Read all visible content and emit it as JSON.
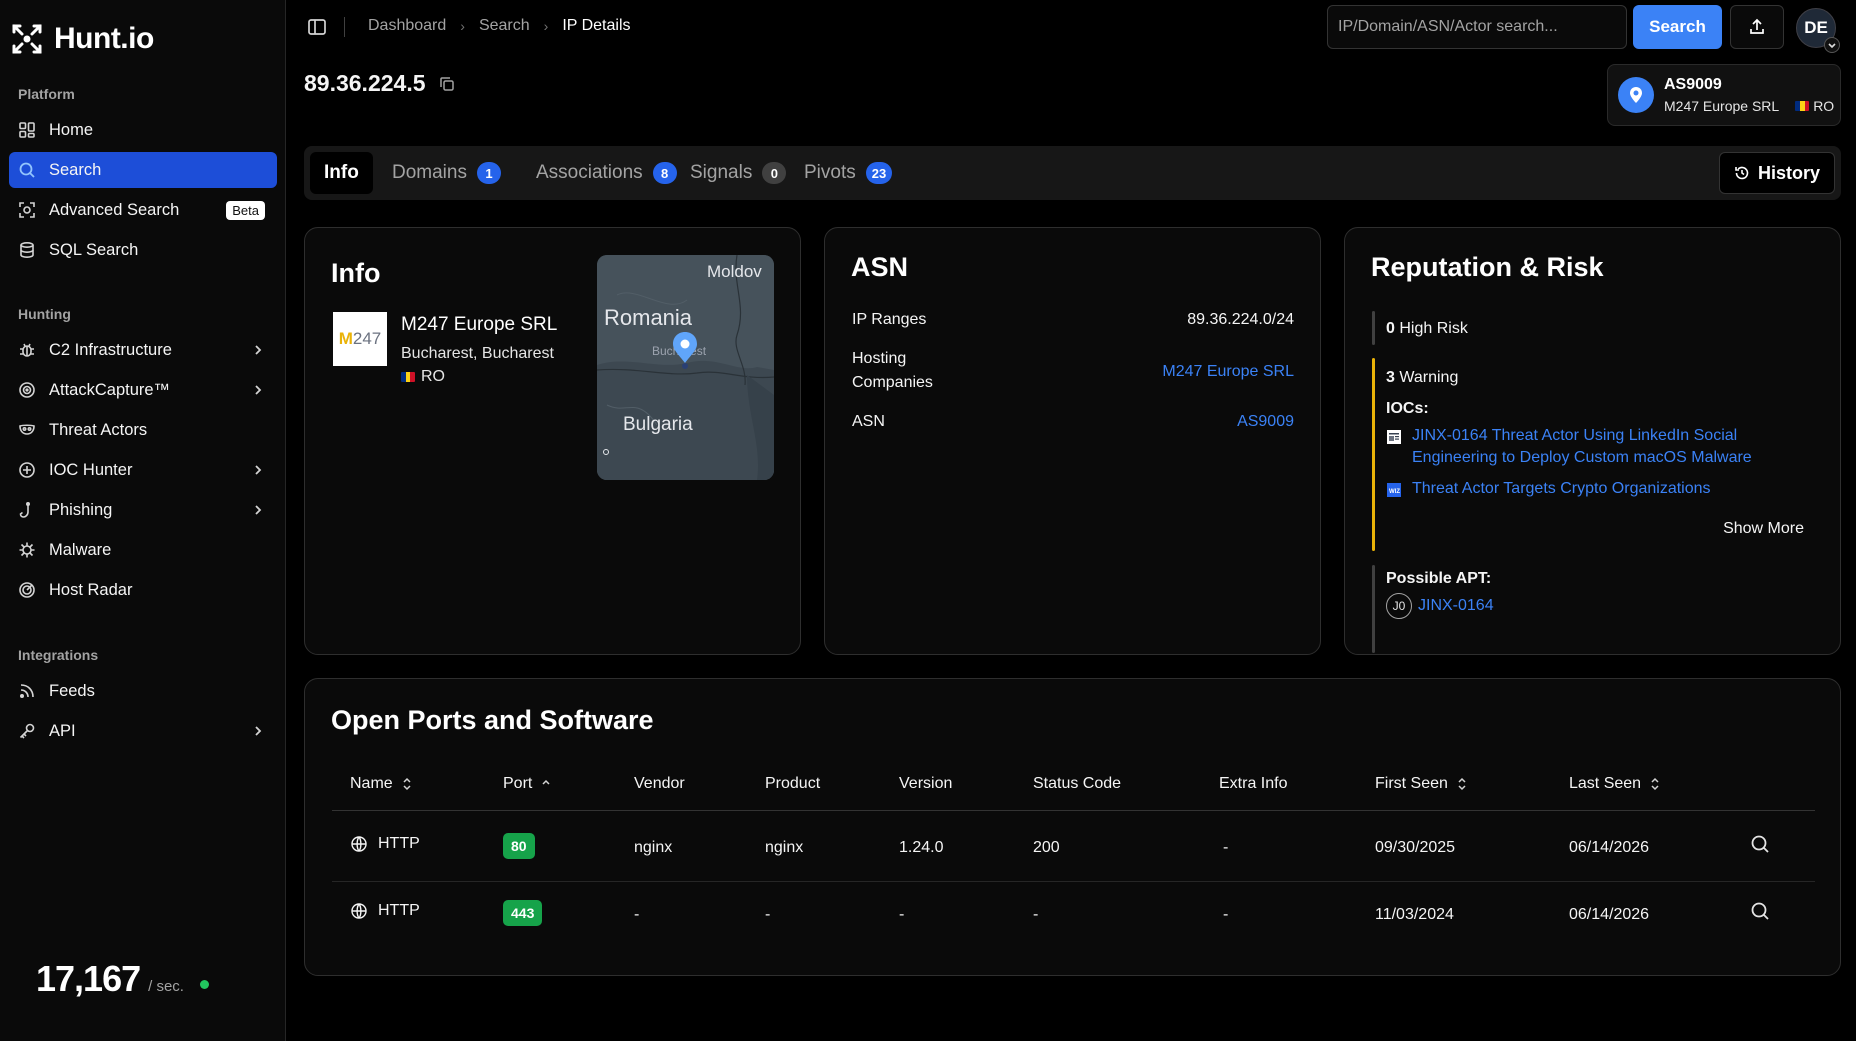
{
  "app": {
    "name": "Hunt.io"
  },
  "sidebar": {
    "sections": [
      {
        "title": "Platform",
        "items": [
          {
            "label": "Home",
            "icon": "grid-icon"
          },
          {
            "label": "Search",
            "icon": "search-icon",
            "active": true
          },
          {
            "label": "Advanced Search",
            "icon": "scan-icon",
            "badge": "Beta"
          },
          {
            "label": "SQL Search",
            "icon": "database-icon"
          }
        ]
      },
      {
        "title": "Hunting",
        "items": [
          {
            "label": "C2 Infrastructure",
            "icon": "bug-icon"
          },
          {
            "label": "AttackCapture™",
            "icon": "target-icon"
          },
          {
            "label": "Threat Actors",
            "icon": "mask-icon"
          },
          {
            "label": "IOC Hunter",
            "icon": "crosshair-icon"
          },
          {
            "label": "Phishing",
            "icon": "hook-icon"
          },
          {
            "label": "Malware",
            "icon": "virus-icon"
          },
          {
            "label": "Host Radar",
            "icon": "radar-icon"
          }
        ]
      },
      {
        "title": "Integrations",
        "items": [
          {
            "label": "Feeds",
            "icon": "rss-icon"
          },
          {
            "label": "API",
            "icon": "key-icon"
          }
        ]
      }
    ],
    "counter": {
      "value": "17,167",
      "unit": "/ sec."
    }
  },
  "header": {
    "breadcrumb": [
      "Dashboard",
      "Search",
      "IP Details"
    ],
    "search_placeholder": "IP/Domain/ASN/Actor search...",
    "search_button": "Search",
    "avatar_initials": "DE"
  },
  "ip": {
    "address": "89.36.224.5",
    "asn_badge": {
      "asn": "AS9009",
      "org": "M247 Europe SRL",
      "country": "RO"
    }
  },
  "tabs": [
    {
      "label": "Info",
      "active": true
    },
    {
      "label": "Domains",
      "count": "1"
    },
    {
      "label": "Associations",
      "count": "8"
    },
    {
      "label": "Signals",
      "count": "0"
    },
    {
      "label": "Pivots",
      "count": "23"
    }
  ],
  "history_button": "History",
  "info_card": {
    "title": "Info",
    "logo_text_m": "M",
    "logo_text_rest": "247",
    "org": "M247 Europe SRL",
    "location": "Bucharest, Bucharest",
    "country": "RO",
    "map_labels": {
      "country1": "Romania",
      "country2": "Bulgaria",
      "country3": "Moldov",
      "city": "Bucharest"
    }
  },
  "asn_card": {
    "title": "ASN",
    "rows": [
      {
        "label": "IP Ranges",
        "value": "89.36.224.0/24"
      },
      {
        "label": "Hosting\nCompanies",
        "value": "M247 Europe SRL"
      },
      {
        "label": "ASN",
        "value": "AS9009"
      }
    ]
  },
  "reputation": {
    "title": "Reputation & Risk",
    "high_risk_count": "0",
    "high_risk_label": "High Risk",
    "warning_count": "3",
    "warning_label": "Warning",
    "iocs_label": "IOCs:",
    "iocs": [
      "JINX-0164 Threat Actor Using LinkedIn Social Engineering to Deploy Custom macOS Malware",
      "Threat Actor Targets Crypto Organizations"
    ],
    "show_more": "Show More",
    "apt_label": "Possible APT:",
    "apt_initials": "J0",
    "apt_name": "JINX-0164"
  },
  "ports": {
    "title": "Open Ports and Software",
    "columns": [
      "Name",
      "Port",
      "Vendor",
      "Product",
      "Version",
      "Status Code",
      "Extra Info",
      "First Seen",
      "Last Seen"
    ],
    "rows": [
      {
        "name": "HTTP",
        "port": "80",
        "vendor": "nginx",
        "product": "nginx",
        "version": "1.24.0",
        "status": "200",
        "extra": "-",
        "first_seen": "09/30/2025",
        "last_seen": "06/14/2026"
      },
      {
        "name": "HTTP",
        "port": "443",
        "vendor": "-",
        "product": "-",
        "version": "-",
        "status": "-",
        "extra": "-",
        "first_seen": "11/03/2024",
        "last_seen": "06/14/2026"
      }
    ]
  },
  "colors": {
    "accent": "#3b82f6",
    "active_nav": "#1d4ed8",
    "warning": "#eab308",
    "port_badge": "#16a34a",
    "live": "#22c55e"
  }
}
